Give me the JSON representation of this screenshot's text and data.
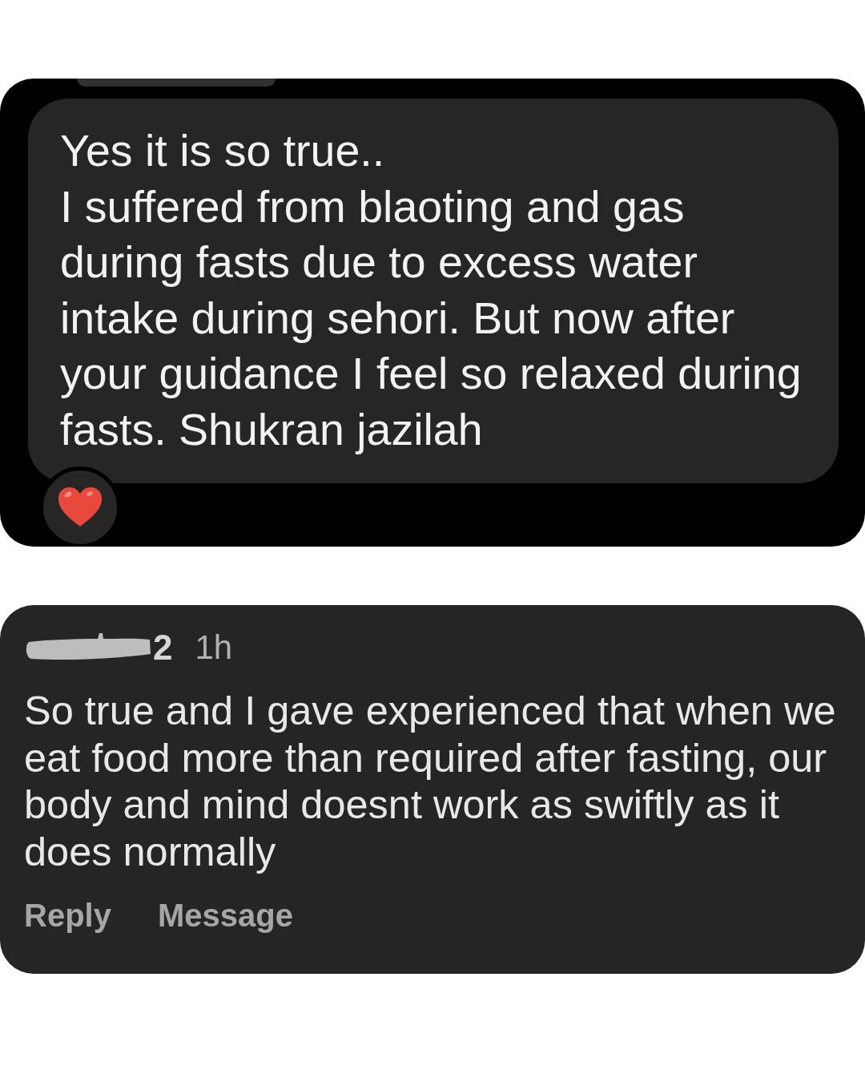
{
  "message": {
    "paragraphs": [
      "Yes it is so true..",
      "I suffered from blaoting and gas during fasts due to excess water intake during sehori. But now after your guidance I feel so relaxed during fasts. Shukran jazilah"
    ]
  },
  "comment": {
    "username_visible": "2",
    "time": "1h",
    "text": "So true and I gave experienced that when we eat food more than required after fasting, our body and mind doesnt work as swiftly as it does normally",
    "actions": [
      "Reply",
      "Message"
    ]
  }
}
